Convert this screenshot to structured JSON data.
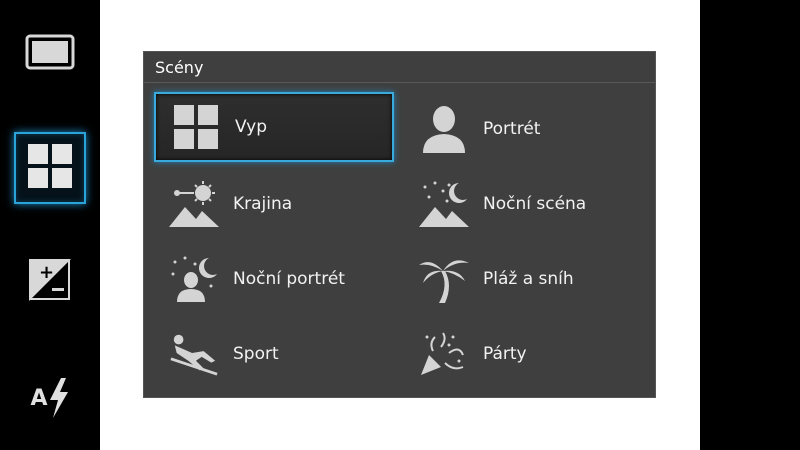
{
  "sidebar": {
    "buttons": [
      {
        "icon": "aspect-ratio-icon"
      },
      {
        "icon": "scenes-grid-icon",
        "selected": true
      },
      {
        "icon": "exposure-compensation-icon"
      },
      {
        "icon": "auto-flash-icon",
        "label": "A"
      }
    ]
  },
  "dialog": {
    "title": "Scény",
    "items": [
      {
        "label": "Vyp",
        "icon": "grid-icon",
        "selected": true
      },
      {
        "label": "Portrét",
        "icon": "portrait-icon"
      },
      {
        "label": "Krajina",
        "icon": "landscape-icon"
      },
      {
        "label": "Noční scéna",
        "icon": "night-scene-icon"
      },
      {
        "label": "Noční portrét",
        "icon": "night-portrait-icon"
      },
      {
        "label": "Pláž a sníh",
        "icon": "palm-tree-icon"
      },
      {
        "label": "Sport",
        "icon": "sport-icon"
      },
      {
        "label": "Párty",
        "icon": "party-icon"
      }
    ]
  },
  "colors": {
    "accent": "#2aa3d8",
    "panel": "#3f3f3f"
  }
}
